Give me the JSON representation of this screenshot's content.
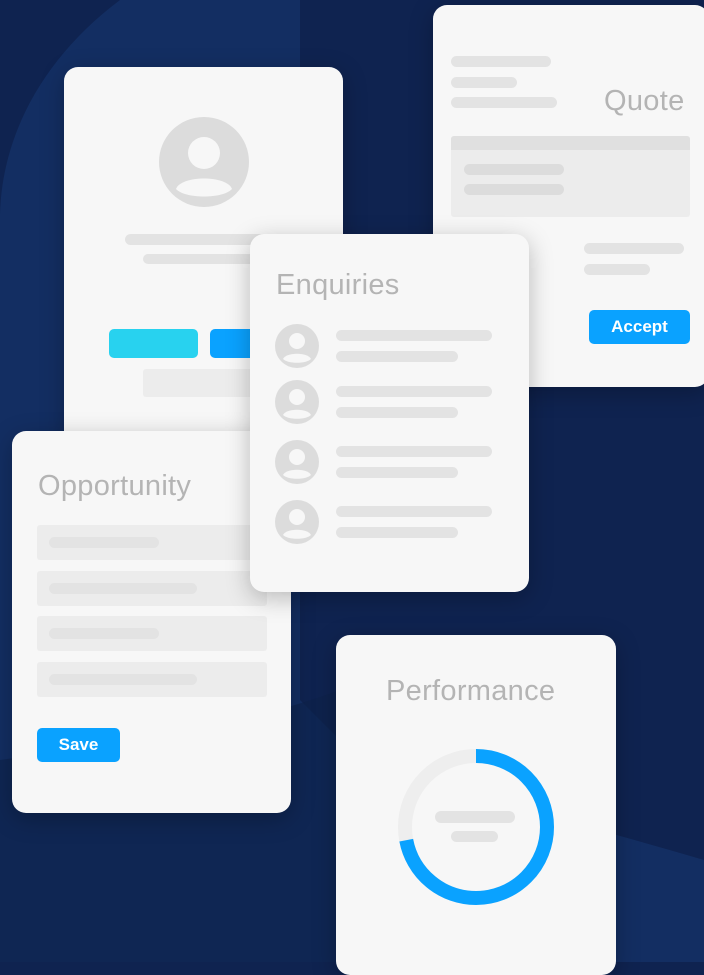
{
  "cards": {
    "quote": {
      "title": "Quote",
      "accept_label": "Accept"
    },
    "enquiries": {
      "title": "Enquiries"
    },
    "opportunity": {
      "title": "Opportunity",
      "save_label": "Save"
    },
    "performance": {
      "title": "Performance",
      "progress": 0.72
    }
  },
  "colors": {
    "background": "#0f2350",
    "accent": "#0aa2ff",
    "accent_light": "#28d2ef",
    "card": "#f7f7f7",
    "placeholder": "#e3e3e3"
  },
  "icons": [
    "user-avatar-icon"
  ]
}
